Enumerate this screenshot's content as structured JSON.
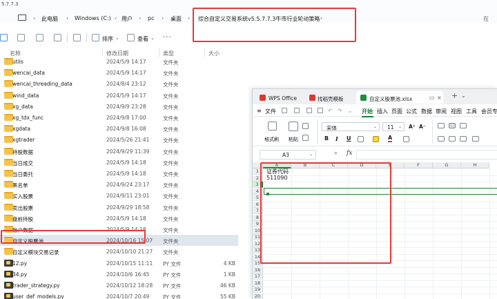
{
  "window_title_fragment": "5.7.7.3",
  "address_bar": {
    "crumbs": [
      "此电脑",
      "Windows (C:)",
      "用户",
      "pc",
      "桌面"
    ],
    "last_crumb": "综合自定义交易系统v5.5.7.7.3牛市行业轮动策略",
    "search_fragment": "在"
  },
  "toolbar": {
    "sort_label": "排序",
    "view_label": "查看",
    "more_label": "···"
  },
  "columns": {
    "name": "名称",
    "date": "修改日期",
    "type": "类型",
    "size": "大小"
  },
  "files": [
    {
      "name": "utils",
      "date": "2024/5/9 14:17",
      "type": "文件夹",
      "size": "",
      "kind": "folder",
      "selected": false
    },
    {
      "name": "wencai_data",
      "date": "2024/5/9 14:17",
      "type": "文件夹",
      "size": "",
      "kind": "folder",
      "selected": false
    },
    {
      "name": "wencai_threading_data",
      "date": "2024/8/4 23:12",
      "type": "文件夹",
      "size": "",
      "kind": "folder",
      "selected": false
    },
    {
      "name": "wind_data",
      "date": "2024/5/9 14:17",
      "type": "文件夹",
      "size": "",
      "kind": "folder",
      "selected": false
    },
    {
      "name": "xg_data",
      "date": "2024/9/9 23:28",
      "type": "文件夹",
      "size": "",
      "kind": "folder",
      "selected": false
    },
    {
      "name": "xg_tdx_func",
      "date": "2024/9/8 17:00",
      "type": "文件夹",
      "size": "",
      "kind": "folder",
      "selected": false
    },
    {
      "name": "xgdata",
      "date": "2024/9/8 16:08",
      "type": "文件夹",
      "size": "",
      "kind": "folder",
      "selected": false
    },
    {
      "name": "xgtrader",
      "date": "2024/5/26 21:41",
      "type": "文件夹",
      "size": "",
      "kind": "folder",
      "selected": false
    },
    {
      "name": "持股数据",
      "date": "2024/9/29 11:39",
      "type": "文件夹",
      "size": "",
      "kind": "folder",
      "selected": false
    },
    {
      "name": "当日成交",
      "date": "2024/5/9 14:18",
      "type": "文件夹",
      "size": "",
      "kind": "folder",
      "selected": false
    },
    {
      "name": "当日委托",
      "date": "2024/5/9 14:18",
      "type": "文件夹",
      "size": "",
      "kind": "folder",
      "selected": false
    },
    {
      "name": "黑名单",
      "date": "2024/9/24 23:17",
      "type": "文件夹",
      "size": "",
      "kind": "folder",
      "selected": false
    },
    {
      "name": "买入股票",
      "date": "2024/9/11 23:01",
      "type": "文件夹",
      "size": "",
      "kind": "folder",
      "selected": false
    },
    {
      "name": "卖出股票",
      "date": "2024/9/29 18:58",
      "type": "文件夹",
      "size": "",
      "kind": "folder",
      "selected": false
    },
    {
      "name": "盘前持股",
      "date": "2024/5/9 14:18",
      "type": "文件夹",
      "size": "",
      "kind": "folder",
      "selected": false
    },
    {
      "name": "账户数据",
      "date": "2024/5/9 14:18",
      "type": "文件夹",
      "size": "",
      "kind": "folder",
      "selected": false
    },
    {
      "name": "自定义股票池",
      "date": "2024/10/16 15:07",
      "type": "文件夹",
      "size": "",
      "kind": "folder",
      "selected": true
    },
    {
      "name": "自定义模块交易记录",
      "date": "2024/10/10 21:27",
      "type": "文件夹",
      "size": "",
      "kind": "folder",
      "selected": false
    },
    {
      "name": "12.py",
      "date": "2024/10/15 11:11",
      "type": "PY 文件",
      "size": "4 KB",
      "kind": "py",
      "selected": false
    },
    {
      "name": "34.py",
      "date": "2024/10/6 16:45",
      "type": "PY 文件",
      "size": "1 KB",
      "kind": "py",
      "selected": false
    },
    {
      "name": "trader_strategy.py",
      "date": "2024/10/12 18:28",
      "type": "PY 文件",
      "size": "46 KB",
      "kind": "py",
      "selected": false
    },
    {
      "name": "user_def_models.py",
      "date": "2024/10/7 20:49",
      "type": "PY 文件",
      "size": "55 KB",
      "kind": "py",
      "selected": false
    }
  ],
  "wps": {
    "tabs": [
      {
        "label": "WPS Office",
        "color": "#d93a30"
      },
      {
        "label": "找稻壳模板",
        "color": "#d93a30"
      },
      {
        "label": "自定义股票池.xlsx",
        "color": "#1e8e3e"
      }
    ],
    "menu": {
      "file": "文件",
      "items": [
        "开始",
        "插入",
        "页面",
        "公式",
        "数据",
        "审阅",
        "视图",
        "工具",
        "会员专"
      ],
      "active": "开始"
    },
    "ribbon": {
      "format_painter": "格式刷",
      "paste": "粘贴",
      "font_name": "宋体",
      "font_size": "11",
      "bold": "B",
      "italic": "I",
      "underline": "U",
      "grow": "A⁺",
      "shrink": "A⁻"
    },
    "name_box": "A3",
    "fx_label": "fx",
    "columns": [
      "A",
      "B",
      "C",
      "D",
      "E",
      "F",
      "G",
      "H"
    ],
    "rows": [
      "1",
      "2",
      "3",
      "4",
      "5",
      "6",
      "7",
      "8",
      "9",
      "10",
      "11",
      "12",
      "13",
      "14",
      "15",
      "16",
      "17",
      "18",
      "19",
      "20"
    ],
    "cells": {
      "A1": "证券代码",
      "A2": "511090"
    },
    "accent": "#1e7d3a"
  },
  "highlight_color": "#e53935"
}
